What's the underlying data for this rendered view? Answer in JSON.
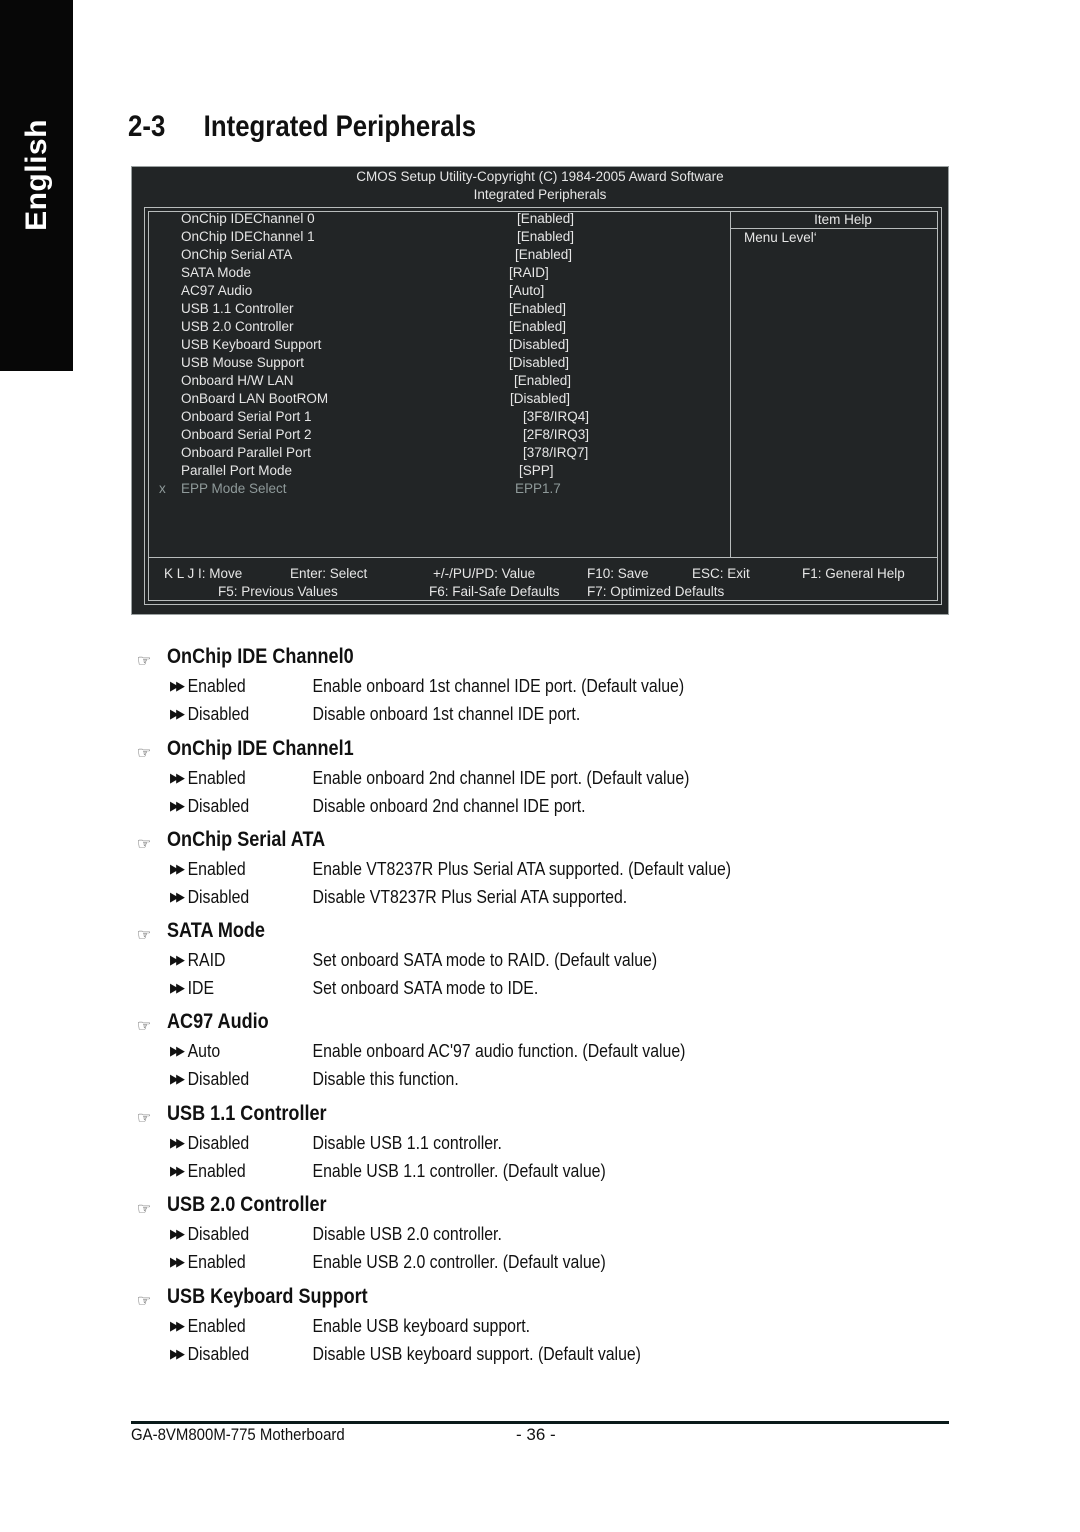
{
  "side_tab": {
    "label": "English"
  },
  "section": {
    "number": "2-3",
    "title": "Integrated Peripherals"
  },
  "bios": {
    "header_line1": "CMOS Setup Utility-Copyright (C) 1984-2005 Award Software",
    "header_line2": "Integrated Peripherals",
    "help_title": "Item Help",
    "help_text": "Menu Level‘",
    "items": [
      {
        "mark": "",
        "label": "OnChip IDEChannel 0",
        "value": "[Enabled]",
        "disabled": false
      },
      {
        "mark": "",
        "label": "OnChip IDEChannel 1",
        "value": "[Enabled]",
        "disabled": false
      },
      {
        "mark": "",
        "label": "OnChip Serial ATA",
        "value": "[Enabled]",
        "disabled": false
      },
      {
        "mark": "",
        "label": "SATA Mode",
        "value": "[RAID]",
        "disabled": false
      },
      {
        "mark": "",
        "label": "AC97 Audio",
        "value": "[Auto]",
        "disabled": false
      },
      {
        "mark": "",
        "label": "USB 1.1 Controller",
        "value": "[Enabled]",
        "disabled": false
      },
      {
        "mark": "",
        "label": "USB 2.0 Controller",
        "value": "[Enabled]",
        "disabled": false
      },
      {
        "mark": "",
        "label": "USB Keyboard Support",
        "value": "[Disabled]",
        "disabled": false
      },
      {
        "mark": "",
        "label": "USB Mouse Support",
        "value": "[Disabled]",
        "disabled": false
      },
      {
        "mark": "",
        "label": "Onboard H/W LAN",
        "value": "[Enabled]",
        "disabled": false
      },
      {
        "mark": "",
        "label": "OnBoard LAN BootROM",
        "value": "[Disabled]",
        "disabled": false
      },
      {
        "mark": "",
        "label": "Onboard Serial Port 1",
        "value": "[3F8/IRQ4]",
        "disabled": false
      },
      {
        "mark": "",
        "label": "Onboard Serial Port 2",
        "value": "[2F8/IRQ3]",
        "disabled": false
      },
      {
        "mark": "",
        "label": "Onboard Parallel Port",
        "value": "[378/IRQ7]",
        "disabled": false
      },
      {
        "mark": "",
        "label": "Parallel Port Mode",
        "value": "[SPP]",
        "disabled": false
      },
      {
        "mark": "x",
        "label": "EPP Mode Select",
        "value": "EPP1.7",
        "disabled": true
      }
    ],
    "keys_row1": [
      {
        "key": "move",
        "label": "K L J I: Move"
      },
      {
        "key": "enter",
        "label": "Enter: Select"
      },
      {
        "key": "value",
        "label": "+/-/PU/PD: Value"
      },
      {
        "key": "f10",
        "label": "F10: Save"
      },
      {
        "key": "esc",
        "label": "ESC: Exit"
      },
      {
        "key": "f1",
        "label": "F1: General Help"
      }
    ],
    "keys_row2": [
      {
        "key": "f5",
        "label": "F5: Previous Values"
      },
      {
        "key": "f6",
        "label": "F6: Fail-Safe Defaults"
      },
      {
        "key": "f7",
        "label": "F7: Optimized Defaults"
      }
    ]
  },
  "descriptions": [
    {
      "title": "OnChip IDE Channel0",
      "options": [
        {
          "name": "Enabled",
          "desc": "Enable onboard 1st channel IDE port. (Default value)"
        },
        {
          "name": "Disabled",
          "desc": "Disable onboard 1st channel IDE port."
        }
      ]
    },
    {
      "title": "OnChip IDE Channel1",
      "options": [
        {
          "name": "Enabled",
          "desc": "Enable onboard 2nd channel IDE port. (Default value)"
        },
        {
          "name": "Disabled",
          "desc": "Disable onboard 2nd channel IDE port."
        }
      ]
    },
    {
      "title": "OnChip Serial ATA",
      "options": [
        {
          "name": "Enabled",
          "desc": "Enable VT8237R Plus Serial ATA supported. (Default value)"
        },
        {
          "name": "Disabled",
          "desc": "Disable VT8237R Plus Serial ATA supported."
        }
      ]
    },
    {
      "title": "SATA Mode",
      "options": [
        {
          "name": "RAID",
          "desc": "Set onboard SATA mode to RAID. (Default value)"
        },
        {
          "name": "IDE",
          "desc": "Set onboard SATA mode to IDE."
        }
      ]
    },
    {
      "title": "AC97 Audio",
      "options": [
        {
          "name": "Auto",
          "desc": "Enable onboard AC'97 audio function. (Default value)"
        },
        {
          "name": "Disabled",
          "desc": "Disable this function."
        }
      ]
    },
    {
      "title": "USB 1.1 Controller",
      "options": [
        {
          "name": "Disabled",
          "desc": "Disable USB 1.1 controller."
        },
        {
          "name": "Enabled",
          "desc": "Enable USB 1.1 controller. (Default value)"
        }
      ]
    },
    {
      "title": "USB 2.0 Controller",
      "options": [
        {
          "name": "Disabled",
          "desc": "Disable USB 2.0 controller."
        },
        {
          "name": "Enabled",
          "desc": "Enable USB 2.0 controller. (Default value)"
        }
      ]
    },
    {
      "title": "USB Keyboard Support",
      "options": [
        {
          "name": "Enabled",
          "desc": "Enable USB keyboard support."
        },
        {
          "name": "Disabled",
          "desc": "Disable USB keyboard support. (Default value)"
        }
      ]
    }
  ],
  "icons": {
    "section_marker": "pointing-hand-icon",
    "option_marker": "double-arrow-icon"
  },
  "footer": {
    "product": "GA-8VM800M-775 Motherboard",
    "page": "- 36 -"
  },
  "colors": {
    "bios_bg": "#222526",
    "bios_text": "#e6e6e6",
    "bios_disabled": "#8f9a9a",
    "side_tab_bg": "#070707"
  }
}
